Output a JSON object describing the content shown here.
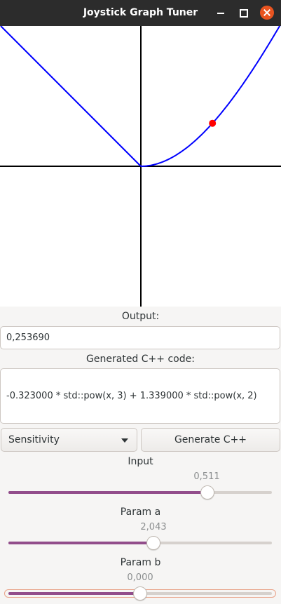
{
  "window": {
    "title": "Joystick Graph Tuner"
  },
  "graph": {
    "coefficients": {
      "a": -0.323,
      "b": 1.339
    },
    "marker_input": 0.511,
    "curve_color": "#0000ff",
    "marker_color": "#ff0000",
    "axis_color": "#000000"
  },
  "output": {
    "label": "Output:",
    "value": "0,253690"
  },
  "code": {
    "label": "Generated C++ code:",
    "text": "-0.323000 * std::pow(x, 3) + 1.339000 * std::pow(x, 2)"
  },
  "mode_select": {
    "selected": "Sensitivity"
  },
  "generate_button": {
    "label": "Generate C++"
  },
  "sliders": {
    "input": {
      "label": "Input",
      "value_text": "0,511",
      "fraction": 0.755
    },
    "param_a": {
      "label": "Param a",
      "value_text": "2,043",
      "fraction": 0.551
    },
    "param_b": {
      "label": "Param b",
      "value_text": "0,000",
      "fraction": 0.5
    }
  },
  "colors": {
    "titlebar": "#2c2c2c",
    "close_button": "#e95420",
    "slider_fill": "#924d8b",
    "focus_ring": "#e9a48a"
  }
}
